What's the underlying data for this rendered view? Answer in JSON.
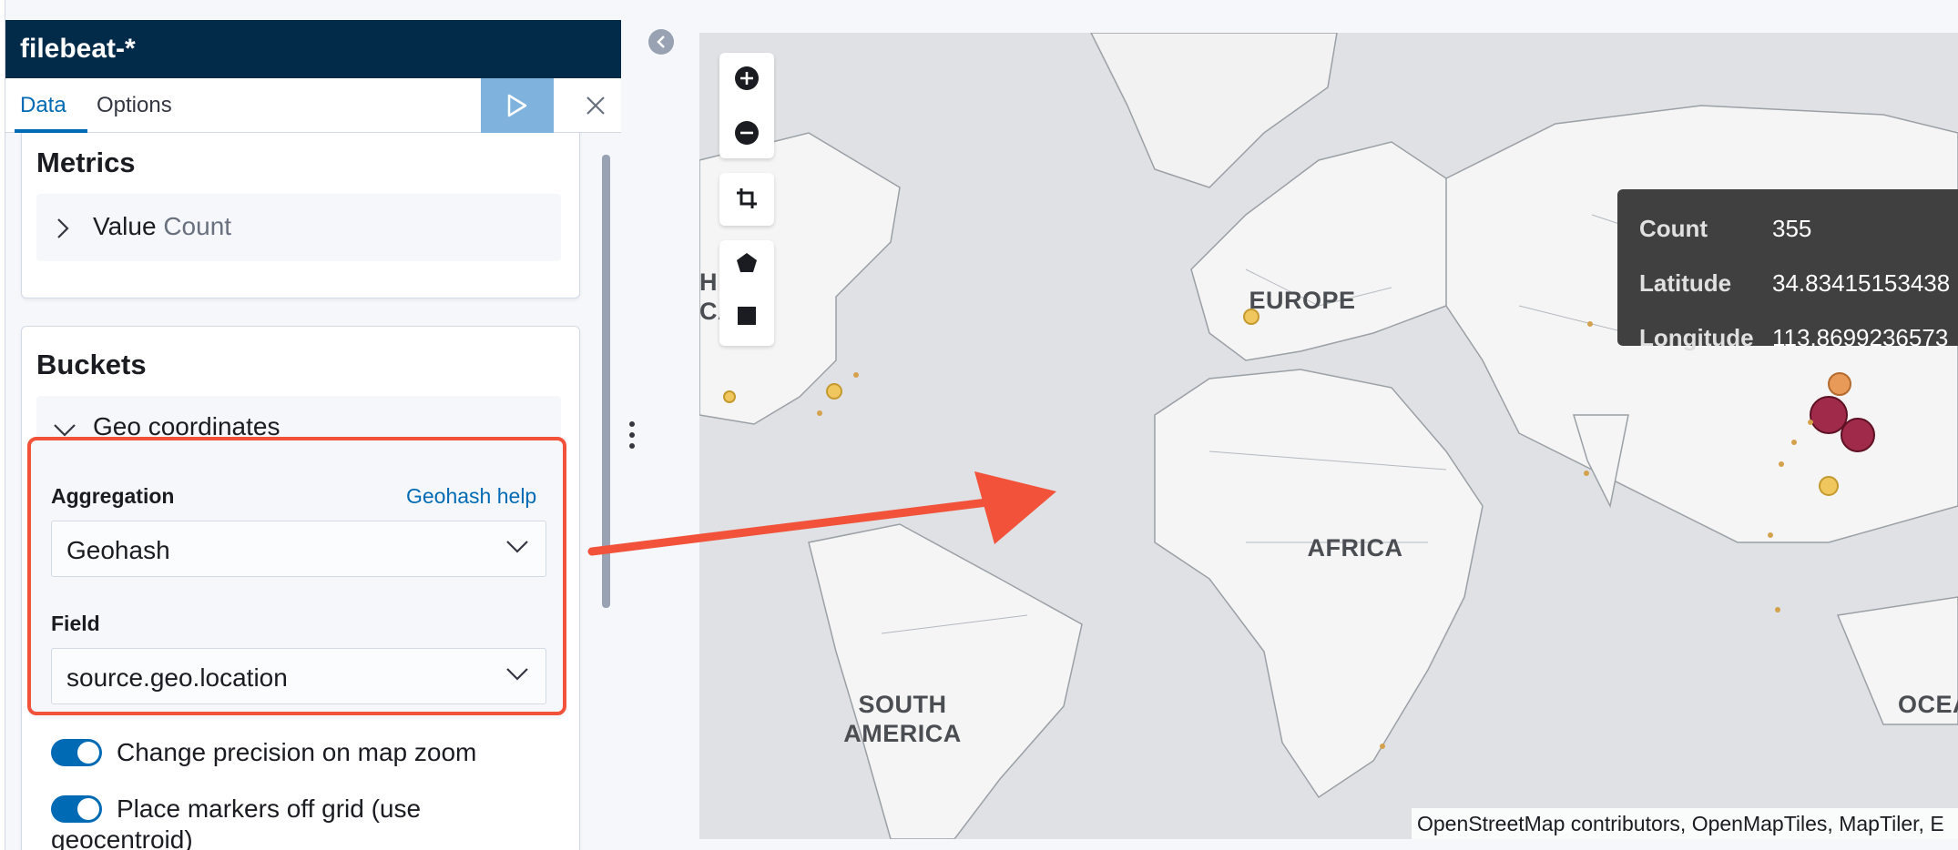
{
  "index_pattern": "filebeat-*",
  "tabs": [
    {
      "label": "Data",
      "active": true
    },
    {
      "label": "Options",
      "active": false
    }
  ],
  "metrics": {
    "title": "Metrics",
    "item_label": "Value",
    "item_agg": "Count"
  },
  "buckets": {
    "title": "Buckets",
    "item_label": "Geo coordinates",
    "aggregation_label": "Aggregation",
    "help_link": "Geohash help",
    "aggregation_value": "Geohash",
    "field_label": "Field",
    "field_value": "source.geo.location",
    "toggle1_label": "Change precision on map zoom",
    "toggle1_on": true,
    "toggle2_label": "Place markers off grid (use geocentroid)",
    "toggle2_on": true
  },
  "map": {
    "continents": [
      "EUROPE",
      "AFRICA",
      "SOUTH AMERICA",
      "OCEA",
      "H",
      "CA"
    ],
    "tooltip": {
      "count_label": "Count",
      "count_value": "355",
      "lat_label": "Latitude",
      "lat_value": "34.83415153438",
      "lon_label": "Longitude",
      "lon_value": "113.8699236573"
    },
    "attribution": "OpenStreetMap contributors, OpenMapTiles, MapTiler, E"
  },
  "colors": {
    "header_bg": "#022a49",
    "accent": "#006bb4",
    "highlight_red": "#f2513a",
    "marker_small": "#f0c75e",
    "marker_large": "#a02a4a"
  }
}
